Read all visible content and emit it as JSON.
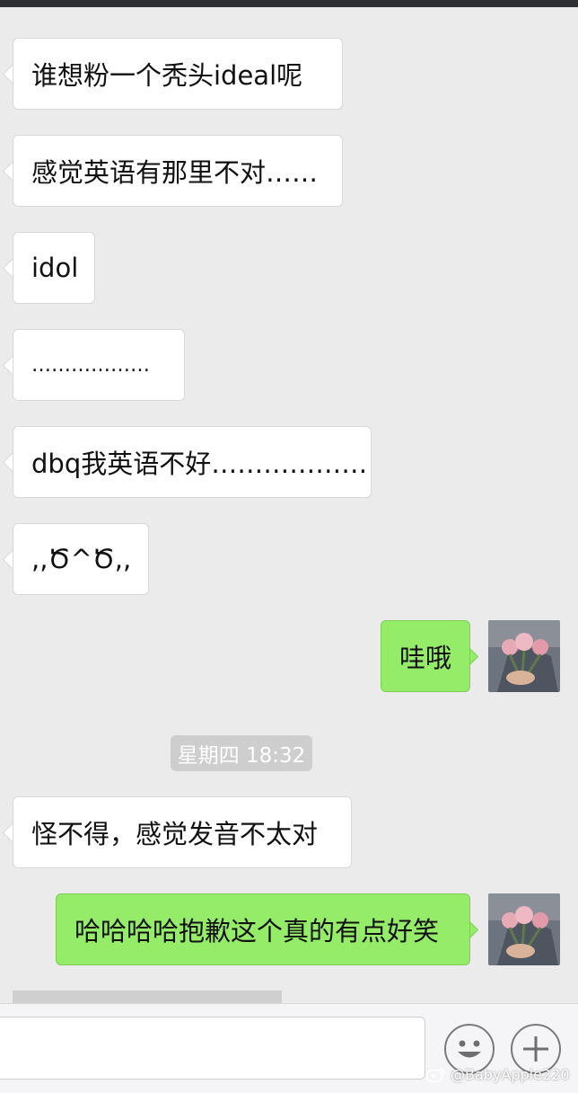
{
  "conversation": {
    "messages": [
      {
        "side": "left",
        "text": "谁想粉一个秃头ideal呢"
      },
      {
        "side": "left",
        "text": "感觉英语有那里不对……"
      },
      {
        "side": "left",
        "text": "idol"
      },
      {
        "side": "left",
        "text": "………………"
      },
      {
        "side": "left",
        "text": "dbq我英语不好………………"
      },
      {
        "side": "left",
        "text": ",,Ծ^Ծ,,"
      },
      {
        "side": "right",
        "text": "哇哦"
      },
      {
        "side": "left",
        "text": "怪不得，感觉发音不太对"
      },
      {
        "side": "right",
        "text": "哈哈哈哈抱歉这个真的有点好笑"
      }
    ],
    "timestamp": "星期四 18:32"
  },
  "input_bar": {
    "emoji_icon": "smiley-face-icon",
    "more_icon": "plus-icon"
  },
  "watermark": {
    "icon": "weibo-logo-icon",
    "text": "@BabyApple220"
  },
  "colors": {
    "background": "#ebebeb",
    "received_bubble": "#ffffff",
    "sent_bubble": "#95ec69",
    "timestamp_bg": "#cecece",
    "top_bar": "#2e2f33"
  }
}
